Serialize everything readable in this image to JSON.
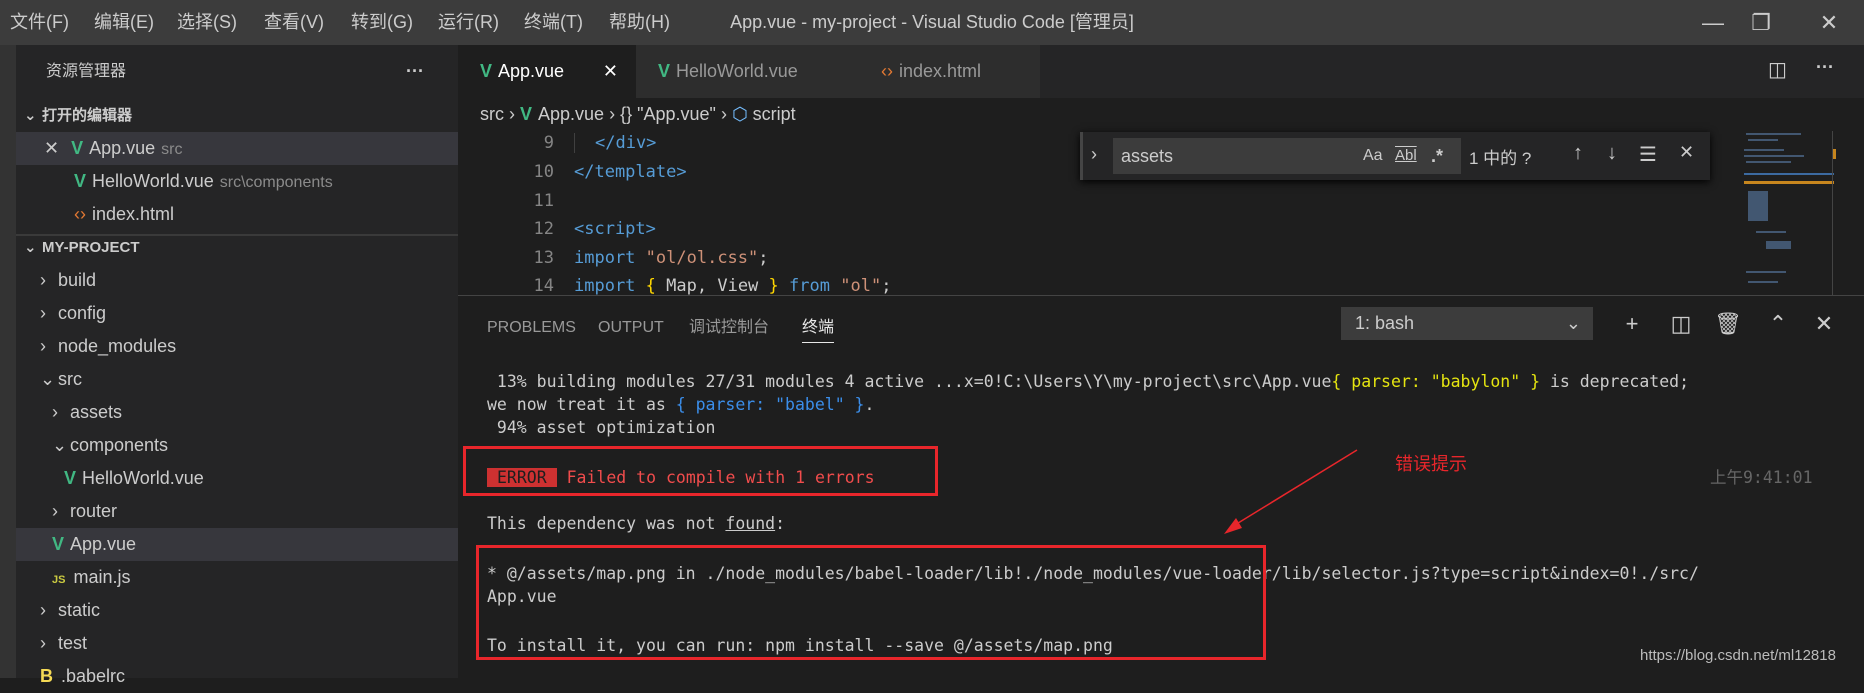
{
  "menu": [
    "文件(F)",
    "编辑(E)",
    "选择(S)",
    "查看(V)",
    "转到(G)",
    "运行(R)",
    "终端(T)",
    "帮助(H)"
  ],
  "window_title": "App.vue - my-project - Visual Studio Code [管理员]",
  "window_controls": {
    "minimize": "—",
    "restore": "❐",
    "close": "✕"
  },
  "sidebar": {
    "title": "资源管理器",
    "more": "···",
    "open_editors": {
      "label": "打开的编辑器",
      "items": [
        {
          "name": "App.vue",
          "path": "src",
          "icon": "vue-icon"
        },
        {
          "name": "HelloWorld.vue",
          "path": "src\\components",
          "icon": "vue-icon"
        },
        {
          "name": "index.html",
          "path": "",
          "icon": "html-icon"
        }
      ]
    },
    "project": {
      "label": "MY-PROJECT",
      "items": [
        {
          "name": "build",
          "type": "folder"
        },
        {
          "name": "config",
          "type": "folder"
        },
        {
          "name": "node_modules",
          "type": "folder"
        },
        {
          "name": "src",
          "type": "folder-open"
        },
        {
          "name": "assets",
          "type": "folder"
        },
        {
          "name": "components",
          "type": "folder-open"
        },
        {
          "name": "HelloWorld.vue",
          "type": "vue"
        },
        {
          "name": "router",
          "type": "folder"
        },
        {
          "name": "App.vue",
          "type": "vue"
        },
        {
          "name": "main.js",
          "type": "js"
        },
        {
          "name": "static",
          "type": "folder"
        },
        {
          "name": "test",
          "type": "folder"
        },
        {
          "name": ".babelrc",
          "type": "babel"
        }
      ]
    }
  },
  "tabs": [
    {
      "label": "App.vue",
      "active": true
    },
    {
      "label": "HelloWorld.vue"
    },
    {
      "label": "index.html"
    }
  ],
  "breadcrumb": [
    "src",
    "App.vue",
    "{} \"App.vue\"",
    "script"
  ],
  "code": {
    "lines": [
      "9",
      "10",
      "11",
      "12",
      "13",
      "14"
    ],
    "l9": "</div>",
    "l10": "</template>",
    "l12": "<script>",
    "l13a": "import",
    "l13b": "\"ol/ol.css\"",
    "l14a": "import",
    "l14b": "Map, View",
    "l14c": "from",
    "l14d": "\"ol\""
  },
  "find": {
    "value": "assets",
    "match_case": "Aa",
    "whole_word": "Abl",
    "regex": ".*",
    "result": "1 中的 ?"
  },
  "panel": {
    "tabs": [
      "PROBLEMS",
      "OUTPUT",
      "调试控制台",
      "终端"
    ],
    "active_tab": "终端",
    "terminal_select": "1: bash"
  },
  "terminal": {
    "l1a": " 13% building modules 27/31 modules 4 active ...x=0!C:\\Users\\Y\\my-project\\src\\App.vue",
    "l1b": "{ parser: \"babylon\" }",
    "l1c": " is deprecated;",
    "l2a": "we now treat it as ",
    "l2b": "{ parser: \"babel\" }",
    "l2c": ".",
    "l3": " 94% asset optimization",
    "error_badge": "ERROR",
    "error_msg": "Failed to compile with 1 errors",
    "timestamp": "上午9:41:01",
    "l5a": "This dependency was not ",
    "l5b": "found",
    ":": ":",
    "l6": "* @/assets/map.png in ./node_modules/babel-loader/lib!./node_modules/vue-loader/lib/selector.js?type=script&index=0!./src/",
    "l7": "App.vue",
    "l8": "To install it, you can run: npm install --save @/assets/map.png"
  },
  "annotation": "错误提示",
  "watermark": "https://blog.csdn.net/ml12818",
  "colors": {
    "error": "#e8262b",
    "vue": "#41b883",
    "accent": "#007acc"
  }
}
